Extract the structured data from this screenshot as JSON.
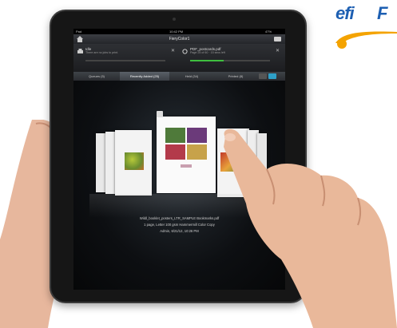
{
  "logo": {
    "text": "efi",
    "extra": "F",
    "swoosh_color": "#f4a300",
    "text_color": "#1d5fb2"
  },
  "status_bar": {
    "carrier": "Pad",
    "time": "10:42 PM",
    "battery": "47%"
  },
  "app": {
    "title": "FieryColor1"
  },
  "jobs": [
    {
      "title": "Idle",
      "subtitle": "There are no jobs to print.",
      "progress": 0
    },
    {
      "title": "PDF_postcards.pdf",
      "subtitle": "Page 25 of 60 · 15 secs left",
      "progress": 0.42
    }
  ],
  "tabs": [
    {
      "label": "Queues (5)",
      "active": false
    },
    {
      "label": "Recently Added (25)",
      "active": true
    },
    {
      "label": "Held (34)",
      "active": false
    },
    {
      "label": "Printed (8)",
      "active": false
    }
  ],
  "selected_job": {
    "filename": "Wildl_booklet_posters_LTR_SAMPLE Bookmarks.pdf",
    "details": "1 page, Letter 100 gsm Hammermill Color Copy",
    "owner": "Admin, 6/21/12, 10:26 PM"
  },
  "colors": {
    "accent": "#2ea0c8",
    "progress": "#3fbf3f"
  }
}
